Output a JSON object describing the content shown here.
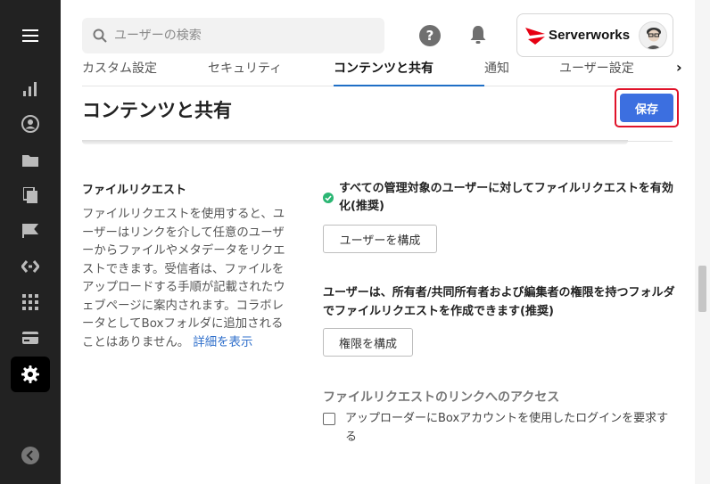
{
  "search": {
    "placeholder": "ユーザーの検索"
  },
  "header": {
    "brand_name": "Serverworks",
    "help_glyph": "?"
  },
  "tabs": [
    {
      "label": "カスタム設定"
    },
    {
      "label": "セキュリティ"
    },
    {
      "label": "コンテンツと共有"
    },
    {
      "label": "通知"
    },
    {
      "label": "ユーザー設定"
    }
  ],
  "tab_next_glyph": "›",
  "page": {
    "title": "コンテンツと共有",
    "save_label": "保存"
  },
  "file_request": {
    "heading": "ファイルリクエスト",
    "description": "ファイルリクエストを使用すると、ユーザーはリンクを介して任意のユーザーからファイルやメタデータをリクエストできます。受信者は、ファイルをアップロードする手順が記載されたウェブページに案内されます。コラボレータとしてBoxフォルダに追加されることはありません。",
    "details_link": "詳細を表示",
    "option1_label": "すべての管理対象のユーザーに対してファイルリクエストを有効化(推奨)",
    "option1_button": "ユーザーを構成",
    "option2_label": "ユーザーは、所有者/共同所有者および編集者の権限を持つフォルダでファイルリクエストを作成できます(推奨)",
    "option2_button": "権限を構成",
    "access_heading": "ファイルリクエストのリンクへのアクセス",
    "access_checkbox_label": "アップローダーにBoxアカウントを使用したログインを要求する"
  },
  "colors": {
    "accent": "#3c6fe0",
    "tab_underline": "#1f6fc6",
    "rail_bg": "#222222",
    "check": "#2bb673",
    "brand_red": "#e60012"
  }
}
